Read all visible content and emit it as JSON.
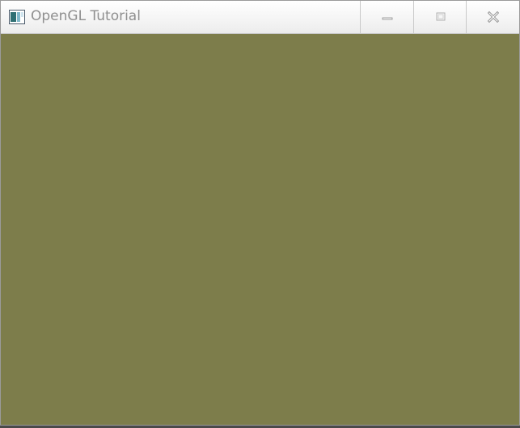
{
  "window": {
    "title": "OpenGL Tutorial",
    "app_icon": "window-app-icon",
    "clear_color": "#7d7d4b"
  },
  "caption_buttons": {
    "minimize_icon": "minimize-icon",
    "maximize_icon": "maximize-icon",
    "close_icon": "close-icon"
  }
}
